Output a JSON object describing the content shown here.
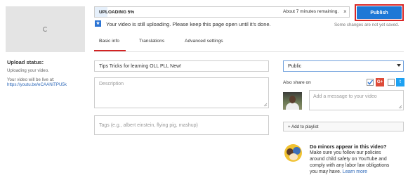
{
  "upload": {
    "progress_label": "UPLOADING 5%",
    "progress_percent": 5,
    "remaining": "About 7 minutes remaining.",
    "publish_label": "Publish",
    "saved_note": "Some changes are not yet saved.",
    "message": "Your video is still uploading. Please keep this page open until it's done.",
    "star_icon": "star-icon",
    "close_icon": "close-icon"
  },
  "sidebar": {
    "status_title": "Upload status:",
    "status_text": "Uploading your video.",
    "live_text": "Your video will be live at:",
    "live_link": "https://youtu.be/eCAANiTPU5k"
  },
  "tabs": [
    {
      "label": "Basic info",
      "active": true
    },
    {
      "label": "Translations",
      "active": false
    },
    {
      "label": "Advanced settings",
      "active": false
    }
  ],
  "form": {
    "title_value": "Tips Tricks for learning OLL PLL New!",
    "description_placeholder": "Description",
    "tags_placeholder": "Tags (e.g., albert einstein, flying pig, mashup)"
  },
  "right": {
    "privacy_value": "Public",
    "also_share": "Also share on",
    "message_placeholder": "Add a message to your video",
    "add_playlist": "+ Add to playlist",
    "google_plus": "G+",
    "twitter_glyph": "🐦",
    "twitter_color": "#1da1f2",
    "gplus_color": "#dd4b39",
    "checkbox_checked": true,
    "minors_title": "Do minors appear in this video?",
    "minors_lines": [
      "Make sure you follow our policies",
      "around child safety on YouTube and",
      "comply with any labor law obligations",
      "you may have."
    ],
    "learn_more": "Learn more"
  },
  "colors": {
    "accent": "#1e78d6",
    "highlight": "#d92626",
    "link": "#2a66b8"
  }
}
